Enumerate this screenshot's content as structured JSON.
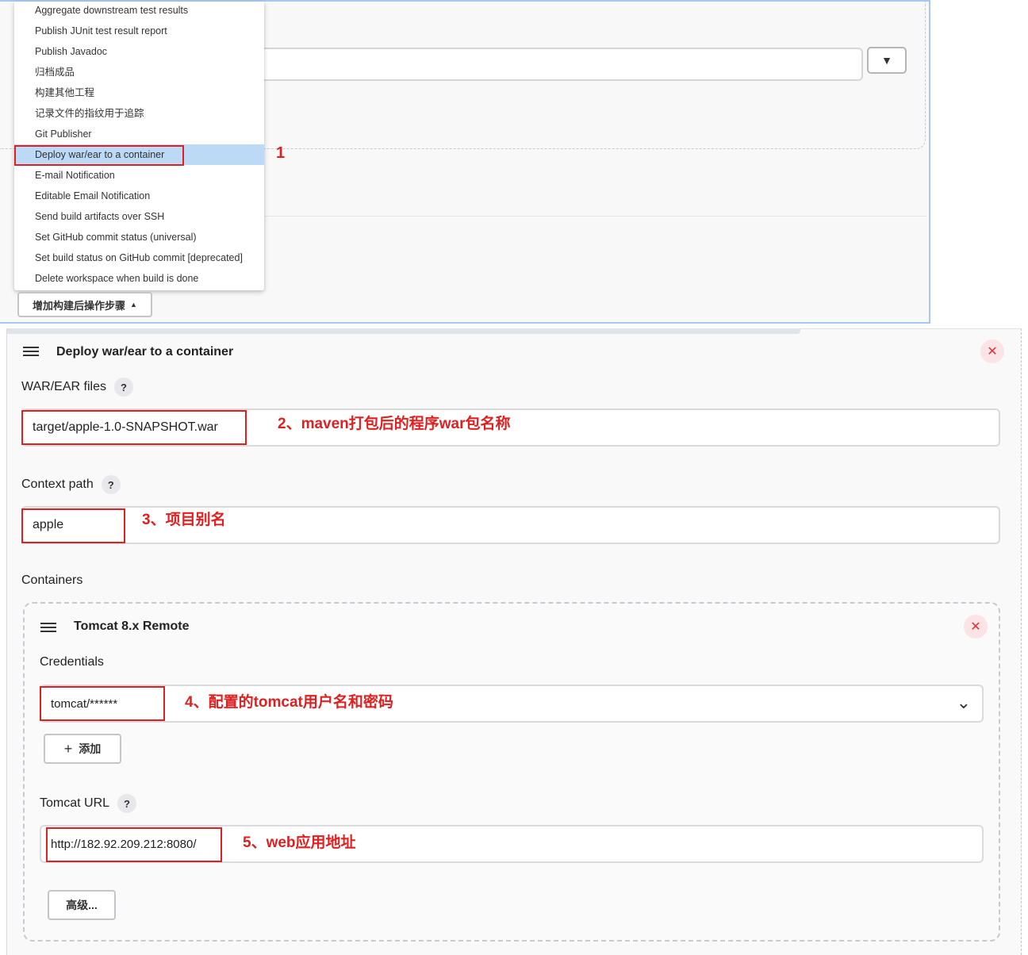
{
  "post_build_menu": {
    "items": [
      "Aggregate downstream test results",
      "Publish JUnit test result report",
      "Publish Javadoc",
      "归档成品",
      "构建其他工程",
      "记录文件的指纹用于追踪",
      "Git Publisher",
      "Deploy war/ear to a container",
      "E-mail Notification",
      "Editable Email Notification",
      "Send build artifacts over SSH",
      "Set GitHub commit status (universal)",
      "Set build status on GitHub commit [deprecated]",
      "Delete workspace when build is done"
    ],
    "selected_index": 7,
    "add_button_label": "增加构建后操作步骤",
    "annotation": "1"
  },
  "deploy_section": {
    "title": "Deploy war/ear to a container",
    "war_files": {
      "label": "WAR/EAR files",
      "value": "target/apple-1.0-SNAPSHOT.war",
      "annotation": "2、maven打包后的程序war包名称"
    },
    "context_path": {
      "label": "Context path",
      "value": "apple",
      "annotation": "3、项目别名"
    },
    "containers_label": "Containers",
    "container": {
      "title": "Tomcat 8.x Remote",
      "credentials": {
        "label": "Credentials",
        "value": "tomcat/******",
        "annotation": "4、配置的tomcat用户名和密码"
      },
      "add_button_label": "添加",
      "tomcat_url": {
        "label": "Tomcat URL",
        "value": "http://182.92.209.212:8080/",
        "annotation": "5、web应用地址"
      },
      "advanced_button_label": "高级..."
    }
  },
  "help_symbol": "?",
  "close_symbol": "✕",
  "colors": {
    "annotation_red": "#e02020",
    "selection_blue": "#bcd9f5",
    "panel_border_blue": "#a8c8f0"
  },
  "icons": [
    "drag-handle-icon",
    "help-icon",
    "close-icon",
    "plus-icon",
    "chevron-down-icon",
    "caret-up-icon",
    "dropdown-arrow-icon"
  ]
}
